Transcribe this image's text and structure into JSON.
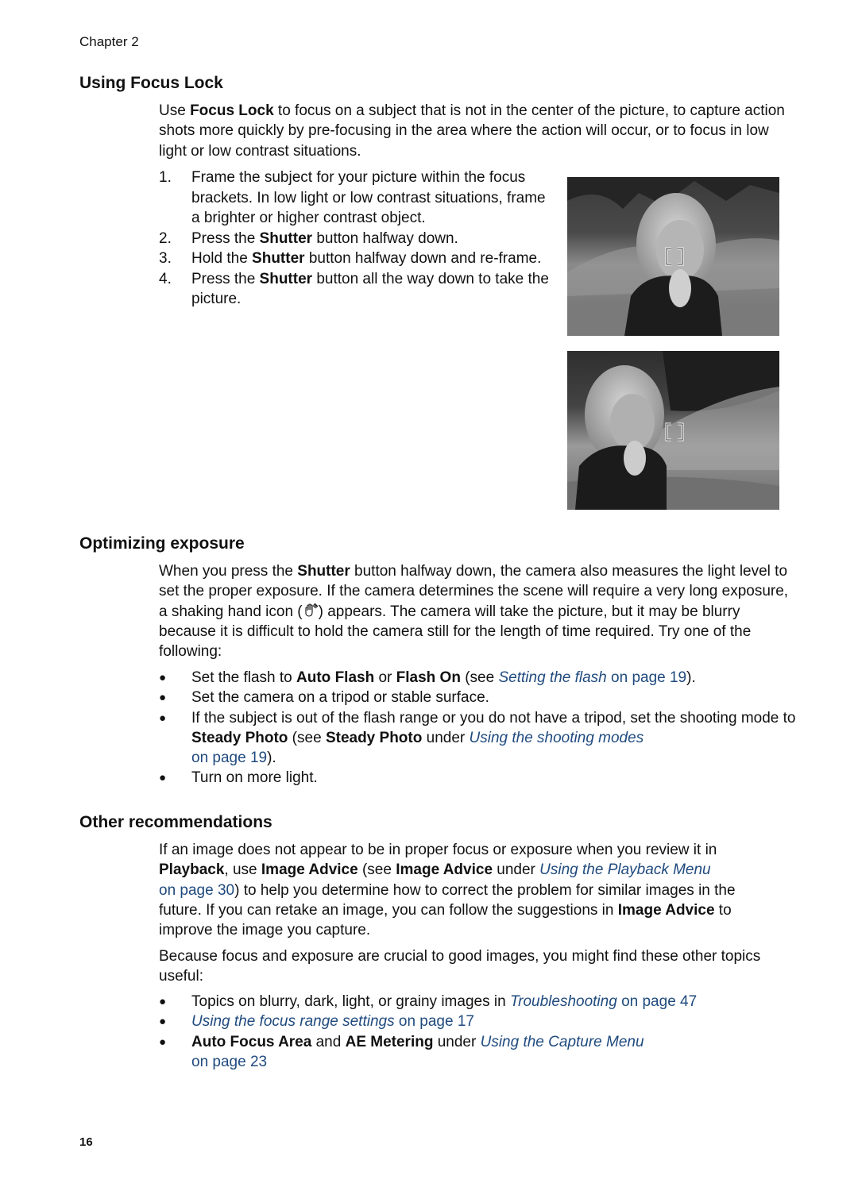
{
  "header": {
    "chapter": "Chapter 2"
  },
  "focus_lock": {
    "heading": "Using Focus Lock",
    "intro": {
      "p1": "Use ",
      "b1": "Focus Lock",
      "p2": " to focus on a subject that is not in the center of the picture, to capture action shots more quickly by pre-focusing in the area where the action will occur, or to focus in low light or low contrast situations."
    },
    "steps": [
      {
        "num": "1.",
        "text": "Frame the subject for your picture within the focus brackets. In low light or low contrast situations, frame a brighter or higher contrast object."
      },
      {
        "num": "2.",
        "pre": "Press the ",
        "bold": "Shutter",
        "post": " button halfway down."
      },
      {
        "num": "3.",
        "pre": "Hold the ",
        "bold": "Shutter",
        "post": " button halfway down and re-frame."
      },
      {
        "num": "4.",
        "pre": "Press the ",
        "bold": "Shutter",
        "post": " button all the way down to take the picture."
      }
    ],
    "images": [
      {
        "alt": "Girl centered in frame with focus brackets on her face",
        "icon": "focus-brackets-icon"
      },
      {
        "alt": "Recomposed shot with girl on left and focus brackets in center",
        "icon": "focus-brackets-icon"
      }
    ]
  },
  "exposure": {
    "heading": "Optimizing exposure",
    "intro": {
      "p1": "When you press the ",
      "b1": "Shutter",
      "p2": " button halfway down, the camera also measures the light level to set the proper exposure. If the camera determines the scene will require a very long exposure, a shaking hand icon (",
      "icon": "shaking-hand-icon",
      "p3": ") appears. The camera will take the picture, but it may be blurry because it is difficult to hold the camera still for the length of time required. Try one of the following:"
    },
    "bullets": {
      "b1": {
        "pre": "Set the flash to ",
        "bold1": "Auto Flash",
        "mid": " or ",
        "bold2": "Flash On",
        "mid2": " (see ",
        "link_italic": "Setting the flash",
        "link_rest": " on page 19",
        "post": ")."
      },
      "b2": {
        "text": "Set the camera on a tripod or stable surface."
      },
      "b3": {
        "pre": "If the subject is out of the flash range or you do not have a tripod, set the shooting mode to ",
        "bold1": "Steady Photo",
        "mid": " (see ",
        "bold2": "Steady Photo",
        "mid2": " under ",
        "link_italic": "Using the shooting modes",
        "link_rest": "on page 19",
        "post": ")."
      },
      "b4": {
        "text": "Turn on more light."
      }
    }
  },
  "other": {
    "heading": "Other recommendations",
    "para1": {
      "p1": "If an image does not appear to be in proper focus or exposure when you review it in ",
      "b1": "Playback",
      "p2": ", use ",
      "b2": "Image Advice",
      "p3": " (see ",
      "b3": "Image Advice",
      "p4": " under ",
      "link_italic": "Using the Playback Menu",
      "link_rest": "on page 30",
      "p5": ") to help you determine how to correct the problem for similar images in the future. If you can retake an image, you can follow the suggestions in ",
      "b4": "Image Advice",
      "p6": " to improve the image you capture."
    },
    "para2": "Because focus and exposure are crucial to good images, you might find these other topics useful:",
    "bullets": {
      "b1": {
        "pre": "Topics on blurry, dark, light, or grainy images in ",
        "link_italic": "Troubleshooting",
        "link_rest": " on page 47"
      },
      "b2": {
        "link_italic": "Using the focus range settings",
        "link_rest": " on page 17"
      },
      "b3": {
        "bold1": "Auto Focus Area",
        "mid": " and ",
        "bold2": "AE Metering",
        "mid2": " under ",
        "link_italic": "Using the Capture Menu",
        "link_rest": "on page 23"
      }
    }
  },
  "footer": {
    "page_number": "16"
  },
  "colors": {
    "text": "#111111",
    "link": "#1f4a7e"
  }
}
